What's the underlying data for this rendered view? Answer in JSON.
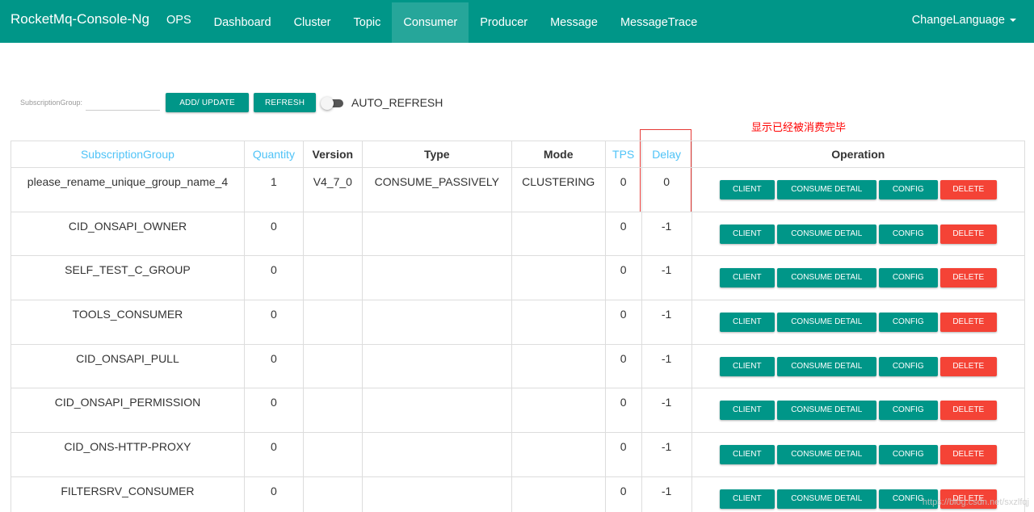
{
  "navbar": {
    "brand": "RocketMq-Console-Ng",
    "items": [
      "OPS",
      "Dashboard",
      "Cluster",
      "Topic",
      "Consumer",
      "Producer",
      "Message",
      "MessageTrace"
    ],
    "active": "Consumer",
    "change_language": "ChangeLanguage"
  },
  "toolbar": {
    "subscription_label": "SubscriptionGroup:",
    "subscription_value": "",
    "add_update_label": "ADD/ UPDATE",
    "refresh_label": "REFRESH",
    "auto_refresh_label": "AUTO_REFRESH",
    "auto_refresh_on": false
  },
  "annotation": "显示已经被消费完毕",
  "table": {
    "columns": [
      "SubscriptionGroup",
      "Quantity",
      "Version",
      "Type",
      "Mode",
      "TPS",
      "Delay",
      "Operation"
    ],
    "rows": [
      {
        "group": "please_rename_unique_group_name_4",
        "quantity": "1",
        "version": "V4_7_0",
        "type": "CONSUME_PASSIVELY",
        "mode": "CLUSTERING",
        "tps": "0",
        "delay": "0"
      },
      {
        "group": "CID_ONSAPI_OWNER",
        "quantity": "0",
        "version": "",
        "type": "",
        "mode": "",
        "tps": "0",
        "delay": "-1"
      },
      {
        "group": "SELF_TEST_C_GROUP",
        "quantity": "0",
        "version": "",
        "type": "",
        "mode": "",
        "tps": "0",
        "delay": "-1"
      },
      {
        "group": "TOOLS_CONSUMER",
        "quantity": "0",
        "version": "",
        "type": "",
        "mode": "",
        "tps": "0",
        "delay": "-1"
      },
      {
        "group": "CID_ONSAPI_PULL",
        "quantity": "0",
        "version": "",
        "type": "",
        "mode": "",
        "tps": "0",
        "delay": "-1"
      },
      {
        "group": "CID_ONSAPI_PERMISSION",
        "quantity": "0",
        "version": "",
        "type": "",
        "mode": "",
        "tps": "0",
        "delay": "-1"
      },
      {
        "group": "CID_ONS-HTTP-PROXY",
        "quantity": "0",
        "version": "",
        "type": "",
        "mode": "",
        "tps": "0",
        "delay": "-1"
      },
      {
        "group": "FILTERSRV_CONSUMER",
        "quantity": "0",
        "version": "",
        "type": "",
        "mode": "",
        "tps": "0",
        "delay": "-1"
      }
    ],
    "operation_labels": {
      "client": "CLIENT",
      "consume_detail": "CONSUME DETAIL",
      "config": "CONFIG",
      "delete": "DELETE"
    }
  },
  "watermark": "https://blog.csdn.net/sxzlfqj",
  "colors": {
    "primary": "#009688",
    "active_nav": "#26a69a",
    "danger": "#f44336",
    "link_header": "#4fc3f7",
    "annotation": "#ff0000"
  }
}
